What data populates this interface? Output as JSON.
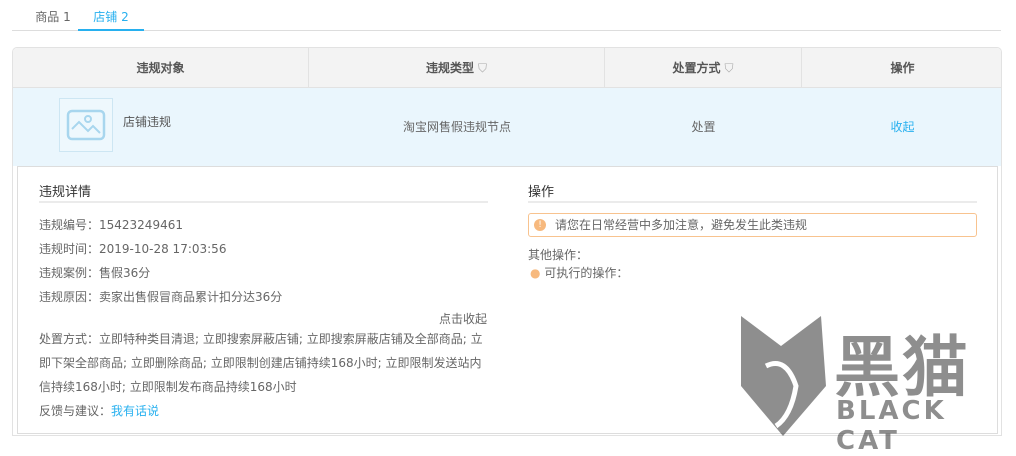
{
  "tabs": [
    {
      "label": "商品 1",
      "active": false
    },
    {
      "label": "店铺 2",
      "active": true
    }
  ],
  "table": {
    "headers": [
      "违规对象",
      "违规类型",
      "处置方式",
      "操作"
    ],
    "row": {
      "object": "店铺违规",
      "type": "淘宝网售假违规节点",
      "method": "处置",
      "action": "收起"
    }
  },
  "detail": {
    "title": "违规详情",
    "items": [
      "违规编号：15423249461",
      "违规时间：2019-10-28 17:03:56",
      "违规案例：售假36分",
      "违规原因：卖家出售假冒商品累计扣分达36分"
    ],
    "collapse_link": "点击收起",
    "method_lines": [
      "处置方式：立即特种类目清退; 立即搜索屏蔽店铺; 立即搜索屏蔽店铺及全部商品; 立",
      "即下架全部商品; 立即删除商品; 立即限制创建店铺持续168小时; 立即限制发送站内",
      "信持续168小时; 立即限制发布商品持续168小时"
    ],
    "feedback_label": "反馈与建议：",
    "feedback_link": "我有话说"
  },
  "operations": {
    "title": "操作",
    "alert": "请您在日常经营中多加注意，避免发生此类违规",
    "other_label": "其他操作：",
    "bullet": "可执行的操作："
  },
  "watermark": {
    "cn": "黑猫",
    "en": "BLACK CAT"
  },
  "colors": {
    "accent": "#27b0ef",
    "row_bg": "#eaf6fd",
    "alert_border": "#f8c38f"
  }
}
